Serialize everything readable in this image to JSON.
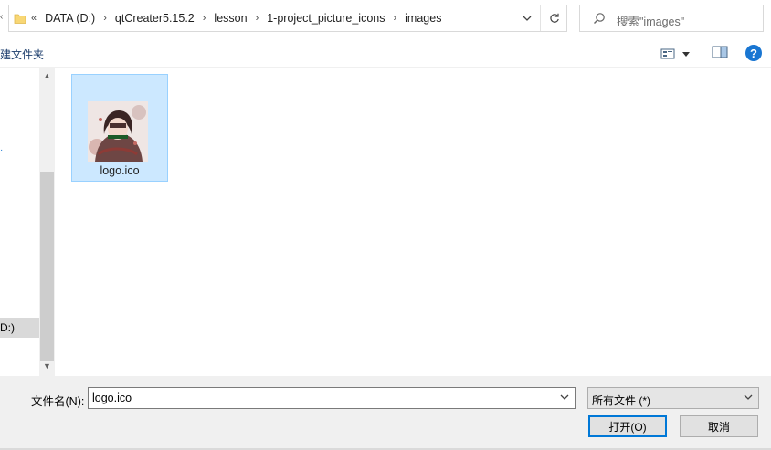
{
  "address": {
    "overflow": "«",
    "breadcrumbs": [
      "DATA (D:)",
      "qtCreater5.15.2",
      "lesson",
      "1-project_picture_icons",
      "images"
    ]
  },
  "search": {
    "placeholder": "搜索\"images\""
  },
  "toolbar": {
    "new_folder": "新建文件夹",
    "new_folder_visible": "建文件夹",
    "help": "?"
  },
  "nav": {
    "drive_label": "D:)"
  },
  "files": [
    {
      "name": "logo.ico",
      "selected": true
    }
  ],
  "bottom": {
    "filename_label": "文件名(N):",
    "filename_value": "logo.ico",
    "filetype_value": "所有文件 (*)",
    "open_label": "打开(O)",
    "cancel_label": "取消"
  },
  "colors": {
    "accent": "#0078d7",
    "selection_bg": "#cce8ff",
    "selection_border": "#99d1ff",
    "help": "#1976d2"
  }
}
